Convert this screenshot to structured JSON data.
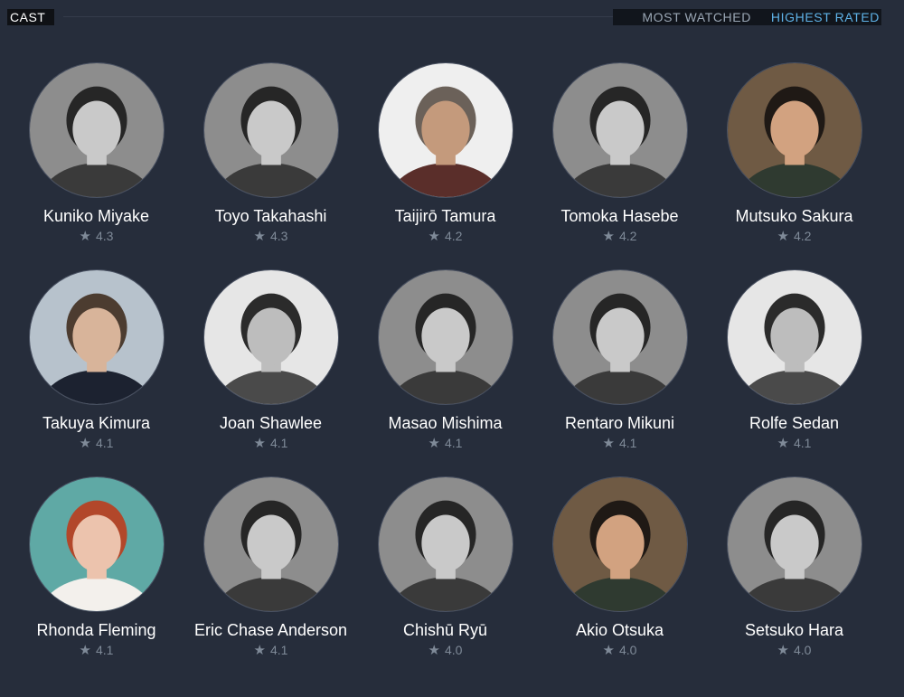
{
  "header": {
    "cast_label": "CAST",
    "sort_tabs": [
      {
        "label": "MOST WATCHED",
        "active": false
      },
      {
        "label": "HIGHEST RATED",
        "active": true
      }
    ]
  },
  "icons": {
    "rating": "star-icon"
  },
  "colors": {
    "background": "#262d3b",
    "active_tab": "#5fb3e8",
    "inactive_tab": "#9aa6b4",
    "rating_text": "#7f8a98"
  },
  "cast": [
    {
      "name": "Kuniko Miyake",
      "rating": "4.3",
      "photo": "bw"
    },
    {
      "name": "Toyo Takahashi",
      "rating": "4.3",
      "photo": "bw"
    },
    {
      "name": "Taijirō Tamura",
      "rating": "4.2",
      "photo": "color-light"
    },
    {
      "name": "Tomoka Hasebe",
      "rating": "4.2",
      "photo": "bw"
    },
    {
      "name": "Mutsuko Sakura",
      "rating": "4.2",
      "photo": "color-warm"
    },
    {
      "name": "Takuya Kimura",
      "rating": "4.1",
      "photo": "color-cool"
    },
    {
      "name": "Joan Shawlee",
      "rating": "4.1",
      "photo": "bw-light"
    },
    {
      "name": "Masao Mishima",
      "rating": "4.1",
      "photo": "bw"
    },
    {
      "name": "Rentaro Mikuni",
      "rating": "4.1",
      "photo": "bw"
    },
    {
      "name": "Rolfe Sedan",
      "rating": "4.1",
      "photo": "bw-light"
    },
    {
      "name": "Rhonda Fleming",
      "rating": "4.1",
      "photo": "color-teal"
    },
    {
      "name": "Eric Chase Anderson",
      "rating": "4.1",
      "photo": "bw"
    },
    {
      "name": "Chishū Ryū",
      "rating": "4.0",
      "photo": "bw"
    },
    {
      "name": "Akio Otsuka",
      "rating": "4.0",
      "photo": "color-warm"
    },
    {
      "name": "Setsuko Hara",
      "rating": "4.0",
      "photo": "bw"
    }
  ]
}
